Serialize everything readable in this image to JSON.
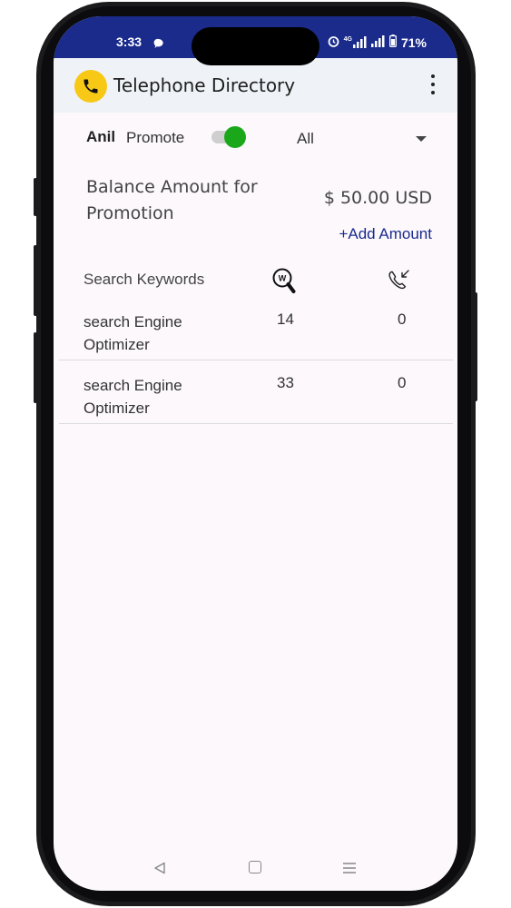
{
  "status_bar": {
    "time": "3:33",
    "network": "4G",
    "battery": "71%"
  },
  "app_bar": {
    "title": "Telephone Directory"
  },
  "filters": {
    "user_name": "Anil",
    "promote_label": "Promote",
    "promote_enabled": true,
    "selected_filter": "All"
  },
  "balance": {
    "label": "Balance Amount for Promotion",
    "amount": "$ 50.00 USD",
    "add_link": "+Add Amount"
  },
  "table": {
    "headers": {
      "keywords": "Search Keywords",
      "views_icon": "search-icon",
      "calls_icon": "incoming-call-icon"
    },
    "rows": [
      {
        "keyword": "search Engine Optimizer",
        "views": "14",
        "calls": "0"
      },
      {
        "keyword": "search Engine Optimizer",
        "views": "33",
        "calls": "0"
      }
    ]
  },
  "colors": {
    "status_bar": "#1a2b8c",
    "accent_link": "#1a2b8c",
    "toggle_on": "#1aa81a",
    "logo": "#f7c815",
    "app_bar": "#eff3f7"
  }
}
